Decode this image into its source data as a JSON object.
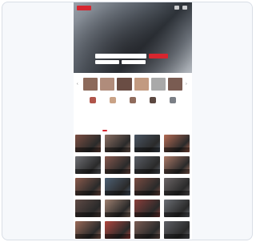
{
  "colors": {
    "accent": "#d6262f",
    "page_background": "#ffffff",
    "card_background": "#f6f8fb"
  },
  "header": {
    "logo_icon": "brand-logo-icon",
    "nav_icons": [
      "menu-icon",
      "user-icon"
    ]
  },
  "hero": {
    "title": "",
    "search": {
      "value": "",
      "placeholder": "",
      "button_label": ""
    },
    "filters": [
      "",
      ""
    ]
  },
  "strip": {
    "items": [
      {
        "color": "#8c6a5b"
      },
      {
        "color": "#b08c7b"
      },
      {
        "color": "#6a4d44"
      },
      {
        "color": "#c29a80"
      },
      {
        "color": "#a9a9a9"
      },
      {
        "color": "#7a5c52"
      }
    ]
  },
  "categories": [
    {
      "icon": "category-icon",
      "label": "",
      "color": "#b0554a"
    },
    {
      "icon": "category-icon",
      "label": "",
      "color": "#c9a286"
    },
    {
      "icon": "category-icon",
      "label": "",
      "color": "#8f6b5c"
    },
    {
      "icon": "category-icon",
      "label": "",
      "color": "#5b4740"
    },
    {
      "icon": "category-icon",
      "label": "",
      "color": "#7b7f86"
    }
  ],
  "tabs": [
    {
      "label": "",
      "active": true
    },
    {
      "label": "",
      "active": false
    },
    {
      "label": "",
      "active": false
    }
  ],
  "grid": {
    "tiles": [
      {
        "caption": "",
        "color": "#7d4f43"
      },
      {
        "caption": "",
        "color": "#8a6e62"
      },
      {
        "caption": "",
        "color": "#4a5563"
      },
      {
        "caption": "",
        "color": "#b46b54"
      },
      {
        "caption": "",
        "color": "#6f7075"
      },
      {
        "caption": "",
        "color": "#86584e"
      },
      {
        "caption": "",
        "color": "#5a5e66"
      },
      {
        "caption": "",
        "color": "#a97866"
      },
      {
        "caption": "",
        "color": "#8a5a4c"
      },
      {
        "caption": "",
        "color": "#4f6175"
      },
      {
        "caption": "",
        "color": "#7a4c42"
      },
      {
        "caption": "",
        "color": "#6b6566"
      },
      {
        "caption": "",
        "color": "#5f4a45"
      },
      {
        "caption": "",
        "color": "#9d7f6f"
      },
      {
        "caption": "",
        "color": "#8a3e3a"
      },
      {
        "caption": "",
        "color": "#6a6d73"
      },
      {
        "caption": "",
        "color": "#9b6a58"
      },
      {
        "caption": "",
        "color": "#b2463e"
      },
      {
        "caption": "",
        "color": "#7b5c53"
      },
      {
        "caption": "",
        "color": "#5e5f65"
      }
    ]
  }
}
